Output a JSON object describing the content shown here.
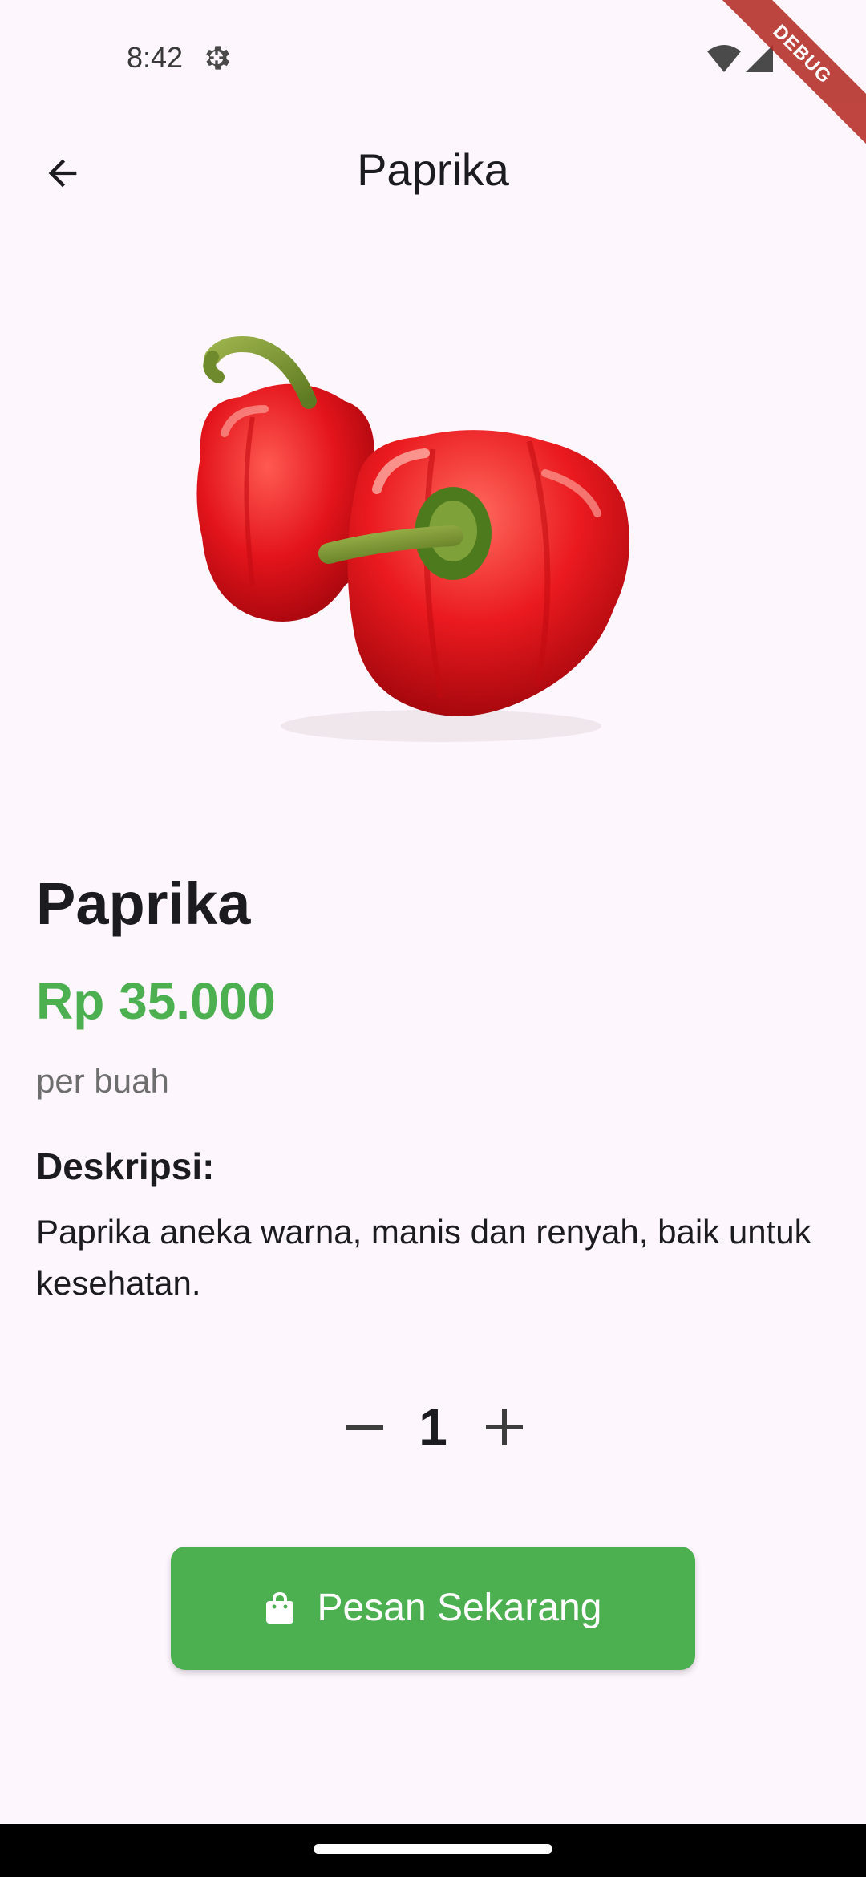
{
  "status_bar": {
    "time": "8:42",
    "icons": [
      "gear-icon",
      "wifi-icon",
      "signal-icon"
    ]
  },
  "debug_banner": "DEBUG",
  "app_bar": {
    "back_icon": "arrow-left-icon",
    "title": "Paprika"
  },
  "product": {
    "image": "red-bell-peppers",
    "name": "Paprika",
    "price": "Rp 35.000",
    "unit": "per buah",
    "description_heading": "Deskripsi:",
    "description": "Paprika aneka warna, manis dan renyah, baik untuk kesehatan."
  },
  "quantity": {
    "value": "1",
    "decrement_icon": "minus-icon",
    "increment_icon": "plus-icon"
  },
  "order_button": {
    "icon": "shopping-bag-icon",
    "label": "Pesan Sekarang"
  },
  "colors": {
    "accent": "#4caf50",
    "background": "#fdf7fd",
    "text": "#1c1b1f",
    "muted_text": "#6e6e6e",
    "debug": "#b3261e"
  }
}
